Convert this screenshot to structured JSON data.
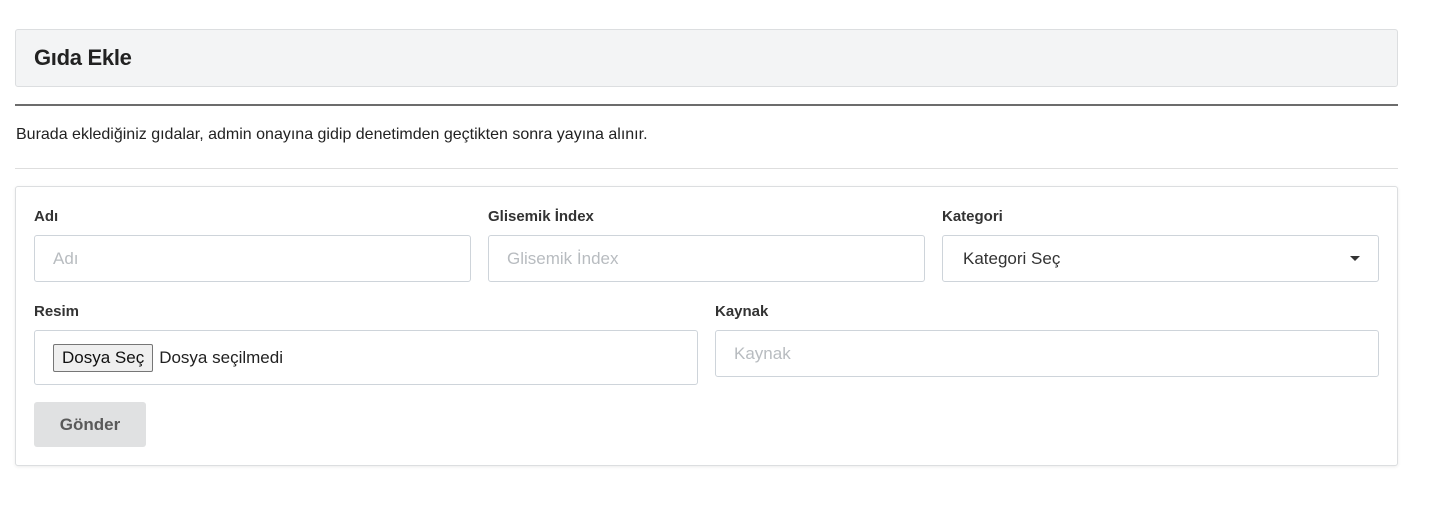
{
  "header": {
    "title": "Gıda Ekle"
  },
  "info": {
    "text": "Burada eklediğiniz gıdalar, admin onayına gidip denetimden geçtikten sonra yayına alınır."
  },
  "form": {
    "name": {
      "label": "Adı",
      "placeholder": "Adı",
      "value": ""
    },
    "glycemic_index": {
      "label": "Glisemik İndex",
      "placeholder": "Glisemik İndex",
      "value": ""
    },
    "category": {
      "label": "Kategori",
      "selected": "Kategori Seç"
    },
    "image": {
      "label": "Resim",
      "button_label": "Dosya Seç",
      "status": "Dosya seçilmedi"
    },
    "source": {
      "label": "Kaynak",
      "placeholder": "Kaynak",
      "value": ""
    },
    "submit_label": "Gönder"
  }
}
